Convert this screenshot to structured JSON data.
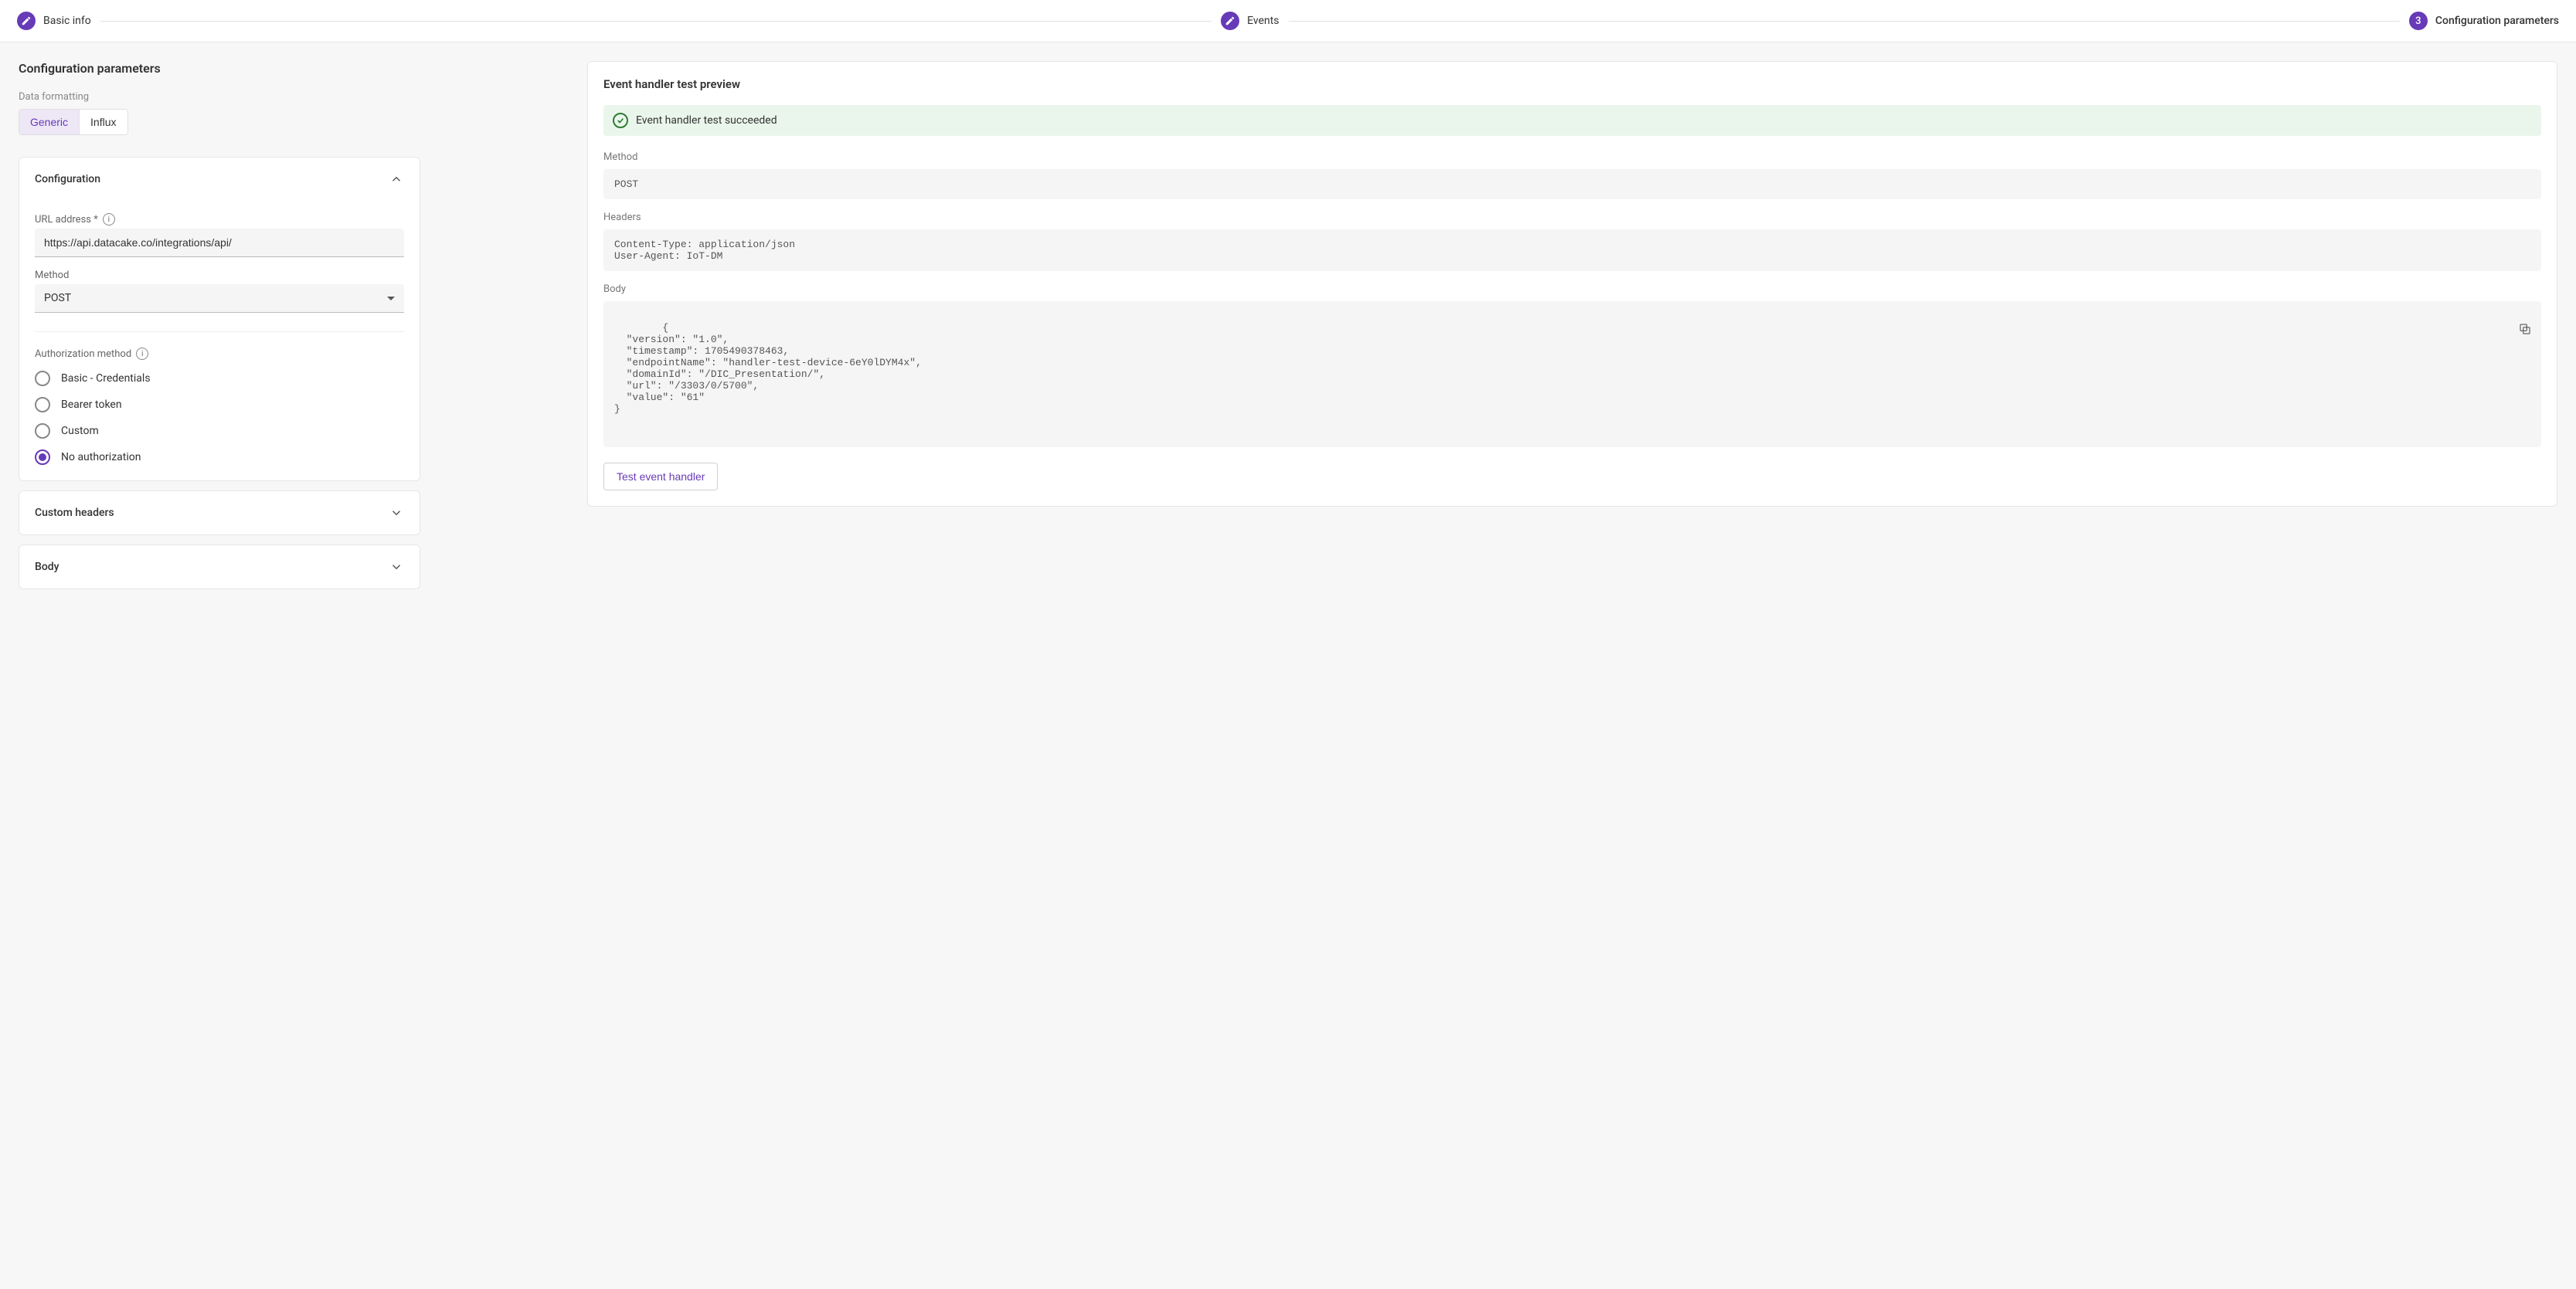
{
  "stepper": {
    "basic_info": "Basic info",
    "events": "Events",
    "config_num": "3",
    "config_label": "Configuration parameters"
  },
  "section_title": "Configuration parameters",
  "formatting": {
    "label": "Data formatting",
    "generic": "Generic",
    "influx": "Influx"
  },
  "config_card": {
    "title": "Configuration",
    "url_label": "URL address *",
    "url_value": "https://api.datacake.co/integrations/api/",
    "method_label": "Method",
    "method_value": "POST",
    "auth_label": "Authorization method",
    "auth_options": {
      "basic": "Basic - Credentials",
      "bearer": "Bearer token",
      "custom": "Custom",
      "none": "No authorization"
    }
  },
  "custom_headers_title": "Custom headers",
  "body_card_title": "Body",
  "preview": {
    "title": "Event handler test preview",
    "success": "Event handler test succeeded",
    "method_label": "Method",
    "method_value": "POST",
    "headers_label": "Headers",
    "headers_value": "Content-Type: application/json\nUser-Agent: IoT-DM",
    "body_label": "Body",
    "body_value": "{\n  \"version\": \"1.0\",\n  \"timestamp\": 1705490378463,\n  \"endpointName\": \"handler-test-device-6eY0lDYM4x\",\n  \"domainId\": \"/DIC_Presentation/\",\n  \"url\": \"/3303/0/5700\",\n  \"value\": \"61\"\n}",
    "test_button": "Test event handler"
  }
}
